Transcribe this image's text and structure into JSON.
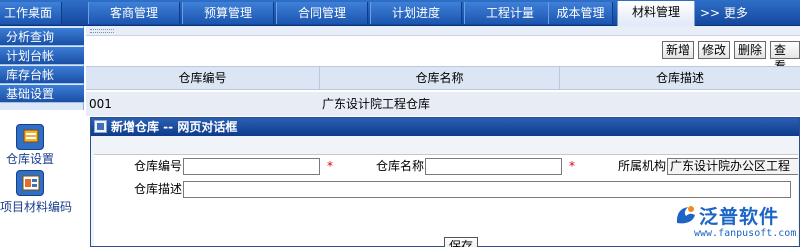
{
  "top_tabs": [
    "工作桌面",
    "客商管理",
    "预算管理",
    "合同管理",
    "计划进度",
    "工程计量",
    "成本管理",
    "材料管理"
  ],
  "more_label": ">> 更多",
  "sidebar": {
    "items": [
      "分析查询",
      "计划台帐",
      "库存台帐",
      "基础设置"
    ],
    "icons": [
      {
        "icon": "warehouse-icon",
        "label": "仓库设置"
      },
      {
        "icon": "material-code-icon",
        "label": "项目材料编码"
      }
    ]
  },
  "toolbar": {
    "new": "新增",
    "edit": "修改",
    "delete": "删除",
    "view": "查看"
  },
  "grid": {
    "columns": [
      "仓库编号",
      "仓库名称",
      "仓库描述"
    ],
    "rows": [
      [
        "001",
        "广东设计院工程仓库",
        ""
      ]
    ]
  },
  "dialog": {
    "title": "新增仓库 -- 网页对话框",
    "fields": {
      "code_label": "仓库编号",
      "code_value": "",
      "name_label": "仓库名称",
      "name_value": "",
      "org_label": "所属机构",
      "org_value": "广东设计院办公区工程",
      "desc_label": "仓库描述",
      "desc_value": ""
    },
    "required_mark": "*",
    "save_label": "保存"
  },
  "watermark": {
    "text": "泛普软件",
    "url": "www.fanpusoft.com"
  },
  "colors": {
    "accent": "#1b55b0",
    "required": "#e00000"
  }
}
